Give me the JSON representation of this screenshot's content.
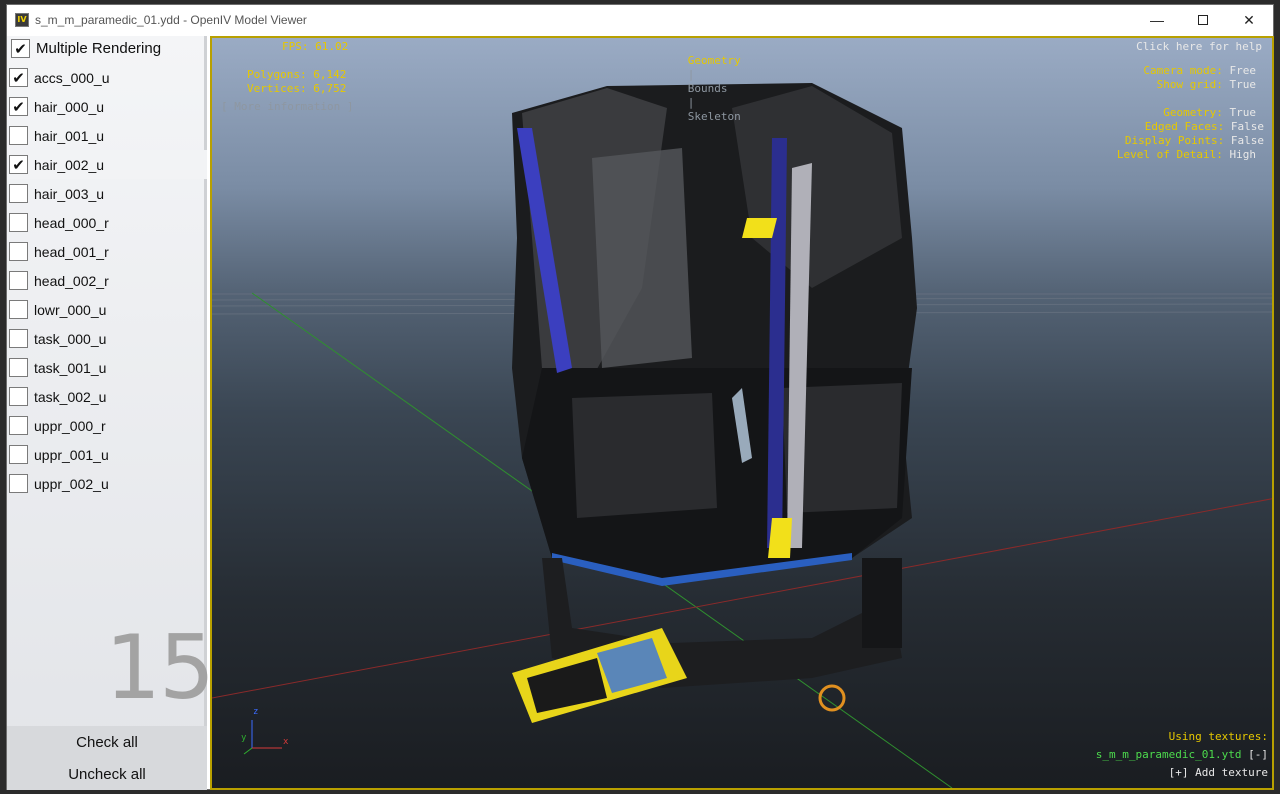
{
  "window": {
    "title": "s_m_m_paramedic_01.ydd - OpenIV Model Viewer",
    "app_icon": "IV"
  },
  "sidebar": {
    "multiple_rendering": {
      "label": "Multiple Rendering",
      "checked": true
    },
    "items": [
      {
        "label": "accs_000_u",
        "checked": true
      },
      {
        "label": "hair_000_u",
        "checked": true
      },
      {
        "label": "hair_001_u",
        "checked": false
      },
      {
        "label": "hair_002_u",
        "checked": true
      },
      {
        "label": "hair_003_u",
        "checked": false
      },
      {
        "label": "head_000_r",
        "checked": false
      },
      {
        "label": "head_001_r",
        "checked": false
      },
      {
        "label": "head_002_r",
        "checked": false
      },
      {
        "label": "lowr_000_u",
        "checked": false
      },
      {
        "label": "task_000_u",
        "checked": false
      },
      {
        "label": "task_001_u",
        "checked": false
      },
      {
        "label": "task_002_u",
        "checked": false
      },
      {
        "label": "uppr_000_r",
        "checked": false
      },
      {
        "label": "uppr_001_u",
        "checked": false
      },
      {
        "label": "uppr_002_u",
        "checked": false
      }
    ],
    "count": "15",
    "check_all": "Check all",
    "uncheck_all": "Uncheck all"
  },
  "viewport": {
    "fps_label": "FPS:",
    "fps": "61.02",
    "polygons_label": "Polygons:",
    "polygons": "6,142",
    "vertices_label": "Vertices:",
    "vertices": "6,752",
    "more_info": "[ More information ]",
    "tabs": {
      "geometry": "Geometry",
      "sep": "|",
      "bounds": "Bounds",
      "skeleton": "Skeleton"
    },
    "help": "Click here for help",
    "camera_label": "Camera mode:",
    "camera": "Free",
    "grid_label": "Show grid:",
    "grid": "True",
    "geometry_label": "Geometry:",
    "geometry": "True",
    "edged_label": "Edged Faces:",
    "edged": "False",
    "points_label": "Display Points:",
    "points": "False",
    "lod_label": "Level of Detail:",
    "lod": "High",
    "textures_label": "Using textures:",
    "texture_file": "s_m_m_paramedic_01.ytd",
    "texture_remove": "[-]",
    "add_texture": "[+] Add texture",
    "axis": {
      "z": "z",
      "y": "y",
      "x": "x"
    }
  },
  "colors": {
    "hud_yellow": "#e6c800",
    "hud_green": "#4ddc4d",
    "viewport_border": "#b8a000"
  }
}
